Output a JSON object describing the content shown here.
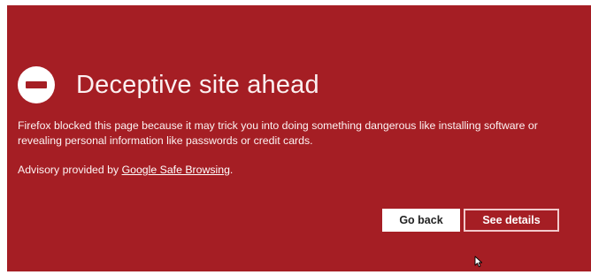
{
  "colors": {
    "background": "#a51e24",
    "text": "#ffffff",
    "primary_button_bg": "#ffffff",
    "primary_button_text": "#222222"
  },
  "warning": {
    "icon": "blocked-icon",
    "title": "Deceptive site ahead",
    "description_line1": "Firefox blocked this page because it may trick you into doing something dangerous like installing software or",
    "description_line2": "revealing personal information like passwords or credit cards.",
    "advisory_prefix": "Advisory provided by ",
    "advisory_link": "Google Safe Browsing",
    "advisory_suffix": "."
  },
  "buttons": {
    "go_back": "Go back",
    "see_details": "See details"
  },
  "cursor": "arrow-cursor-icon"
}
